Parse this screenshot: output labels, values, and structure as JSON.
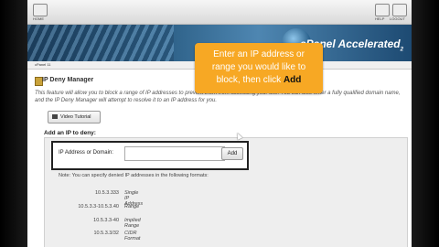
{
  "toolbar": {
    "home_label": "HOME",
    "help_label": "HELP",
    "logout_label": "LOGOUT"
  },
  "banner": {
    "brand": "cPanel Accelerated",
    "brand_suffix": "2"
  },
  "breadcrumb": "cPanel 11",
  "page": {
    "title": "IP Deny Manager",
    "description": "This feature will allow you to block a range of IP addresses to prevent them from accessing your site. You can also enter a fully qualified domain name, and the IP Deny Manager will attempt to resolve it to an IP address for you.",
    "video_button": "Video Tutorial",
    "section_title": "Add an IP to deny:",
    "field_label": "IP Address or Domain:",
    "field_value": "",
    "add_button": "Add",
    "note": "Note: You can specify denied IP addresses in the following formats:",
    "formats": [
      {
        "value": "10.5.3.333",
        "desc": "Single IP Address"
      },
      {
        "value": "10.5.3.3-10.5.3.40",
        "desc": "Range"
      },
      {
        "value": "10.5.3.3-40",
        "desc": "Implied Range"
      },
      {
        "value": "10.5.3.3/32",
        "desc": "CIDR Format"
      }
    ]
  },
  "callout": {
    "line1": "Enter an IP address or",
    "line2": "range you would like to",
    "line3_pre": "block, then click ",
    "line3_bold": "Add"
  },
  "colors": {
    "callout": "#f7a824",
    "banner_dark": "#0f2b45",
    "banner_light": "#4e86b1"
  }
}
